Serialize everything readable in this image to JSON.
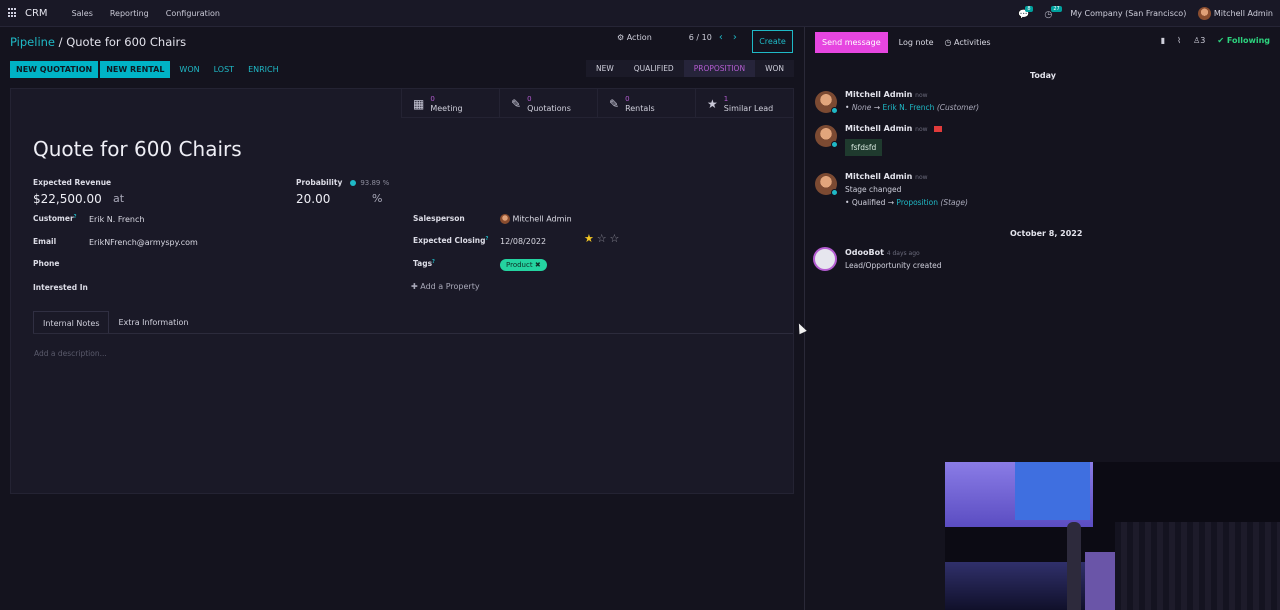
{
  "topnav": {
    "app_name": "CRM",
    "menu": [
      "Sales",
      "Reporting",
      "Configuration"
    ],
    "messages_count": "8",
    "activities_count": "27",
    "company": "My Company (San Francisco)",
    "user": "Mitchell Admin"
  },
  "breadcrumb": {
    "parent": "Pipeline",
    "separator": "/",
    "current": "Quote for 600 Chairs"
  },
  "control": {
    "action_label": "Action",
    "pager": "6 / 10",
    "create_label": "Create"
  },
  "statusbar": {
    "buttons": [
      "NEW QUOTATION",
      "NEW RENTAL",
      "WON",
      "LOST",
      "ENRICH"
    ],
    "stages": [
      "NEW",
      "QUALIFIED",
      "PROPOSITION",
      "WON"
    ],
    "active_stage": "PROPOSITION"
  },
  "smart_buttons": [
    {
      "count": "0",
      "label": "Meeting",
      "icon": "calendar-icon"
    },
    {
      "count": "0",
      "label": "Quotations",
      "icon": "edit-icon"
    },
    {
      "count": "0",
      "label": "Rentals",
      "icon": "edit-icon"
    },
    {
      "count": "1",
      "label": "Similar Lead",
      "icon": "star-icon"
    }
  ],
  "form": {
    "title": "Quote for 600 Chairs",
    "expected_revenue_label": "Expected Revenue",
    "expected_revenue": "$22,500.00",
    "at_label": "at",
    "probability_label": "Probability",
    "probability_auto": "93.89 %",
    "probability": "20.00",
    "percent": "%",
    "customer_label": "Customer",
    "customer": "Erik N. French",
    "email_label": "Email",
    "email": "ErikNFrench@armyspy.com",
    "phone_label": "Phone",
    "interested_label": "Interested In",
    "salesperson_label": "Salesperson",
    "salesperson": "Mitchell Admin",
    "closing_label": "Expected Closing",
    "closing": "12/08/2022",
    "priority_stars": 1,
    "tags_label": "Tags",
    "tag": "Product",
    "add_property": "Add a Property",
    "tabs": [
      "Internal Notes",
      "Extra Information"
    ],
    "description_placeholder": "Add a description..."
  },
  "chatter": {
    "send_message": "Send message",
    "log_note": "Log note",
    "activities": "Activities",
    "followers_count": "3",
    "following": "Following",
    "today": "Today",
    "msg1": {
      "author": "Mitchell Admin",
      "when": "now",
      "old": "None",
      "new": "Erik N. French",
      "field": "(Customer)"
    },
    "msg2": {
      "author": "Mitchell Admin",
      "when": "now",
      "body": "fsfdsfd"
    },
    "msg3": {
      "author": "Mitchell Admin",
      "when": "now",
      "text": "Stage changed",
      "old": "Qualified",
      "new": "Proposition",
      "field": "(Stage)"
    },
    "older_date": "October 8, 2022",
    "msg4": {
      "author": "OdooBot",
      "when": "4 days ago",
      "text": "Lead/Opportunity created"
    }
  },
  "colors": {
    "accent_teal": "#1fb9c6",
    "accent_purple": "#b45cd1",
    "send_pink": "#e646e0",
    "following_green": "#2dd37e",
    "tag_green": "#24d3a0"
  }
}
